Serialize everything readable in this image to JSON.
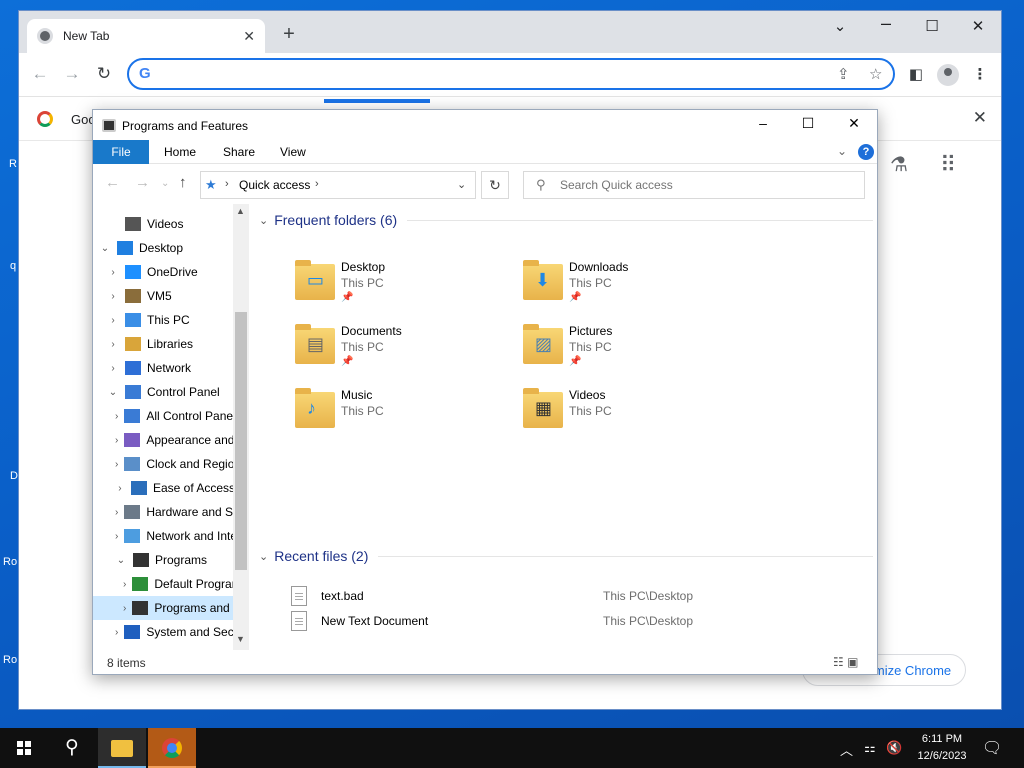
{
  "desktop": {
    "fragments": [
      "R",
      "q",
      "D",
      "Ro",
      "Ro"
    ]
  },
  "chrome": {
    "tab_title": "New Tab",
    "tab_close": "✕",
    "new_tab": "+",
    "minimize": "⌄",
    "maximize": "☐",
    "close": "✕",
    "back": "←",
    "forward": "→",
    "reload": "↻",
    "omnibox_value": "",
    "google_g": "G",
    "bookmark_text": "Goo",
    "bookmark_close": "✕",
    "partial_text": "s",
    "customize_label": "Customize Chrome",
    "customize_pen": "✎"
  },
  "explorer": {
    "title": "Programs and Features",
    "ribbon_tabs": [
      "File",
      "Home",
      "Share",
      "View"
    ],
    "help": "?",
    "address_location": "Quick access",
    "search_placeholder": "Search Quick access",
    "nav_items": [
      {
        "label": "Videos",
        "chev": "",
        "indent": 1
      },
      {
        "label": "Desktop",
        "chev": "⌄",
        "indent": 0
      },
      {
        "label": "OneDrive",
        "chev": "›",
        "indent": 1
      },
      {
        "label": "VM5",
        "chev": "›",
        "indent": 1
      },
      {
        "label": "This PC",
        "chev": "›",
        "indent": 1
      },
      {
        "label": "Libraries",
        "chev": "›",
        "indent": 1
      },
      {
        "label": "Network",
        "chev": "›",
        "indent": 1
      },
      {
        "label": "Control Panel",
        "chev": "⌄",
        "indent": 1
      },
      {
        "label": "All Control Panel Items",
        "chev": "›",
        "indent": 2
      },
      {
        "label": "Appearance and Personalization",
        "chev": "›",
        "indent": 2
      },
      {
        "label": "Clock and Region",
        "chev": "›",
        "indent": 2
      },
      {
        "label": "Ease of Access",
        "chev": "›",
        "indent": 2
      },
      {
        "label": "Hardware and Sound",
        "chev": "›",
        "indent": 2
      },
      {
        "label": "Network and Internet",
        "chev": "›",
        "indent": 2
      },
      {
        "label": "Programs",
        "chev": "⌄",
        "indent": 2
      },
      {
        "label": "Default Programs",
        "chev": "›",
        "indent": 3
      },
      {
        "label": "Programs and Features",
        "chev": "›",
        "indent": 3
      },
      {
        "label": "System and Security",
        "chev": "›",
        "indent": 2
      }
    ],
    "frequent_title": "Frequent folders (6)",
    "frequent_folders": [
      {
        "name": "Desktop",
        "location": "This PC",
        "overlay": "desktop-overlay"
      },
      {
        "name": "Downloads",
        "location": "This PC",
        "overlay": "download-arrow"
      },
      {
        "name": "Documents",
        "location": "This PC",
        "overlay": "document-overlay"
      },
      {
        "name": "Pictures",
        "location": "This PC",
        "overlay": "picture-overlay"
      },
      {
        "name": "Music",
        "location": "This PC",
        "overlay": "music-note"
      },
      {
        "name": "Videos",
        "location": "This PC",
        "overlay": "film-overlay"
      }
    ],
    "recent_title": "Recent files (2)",
    "recent_files": [
      {
        "name": "text.bad",
        "path": "This PC\\Desktop"
      },
      {
        "name": "New Text Document",
        "path": "This PC\\Desktop"
      }
    ],
    "status": "8 items"
  },
  "taskbar": {
    "time": "6:11 PM",
    "date": "12/6/2023"
  }
}
